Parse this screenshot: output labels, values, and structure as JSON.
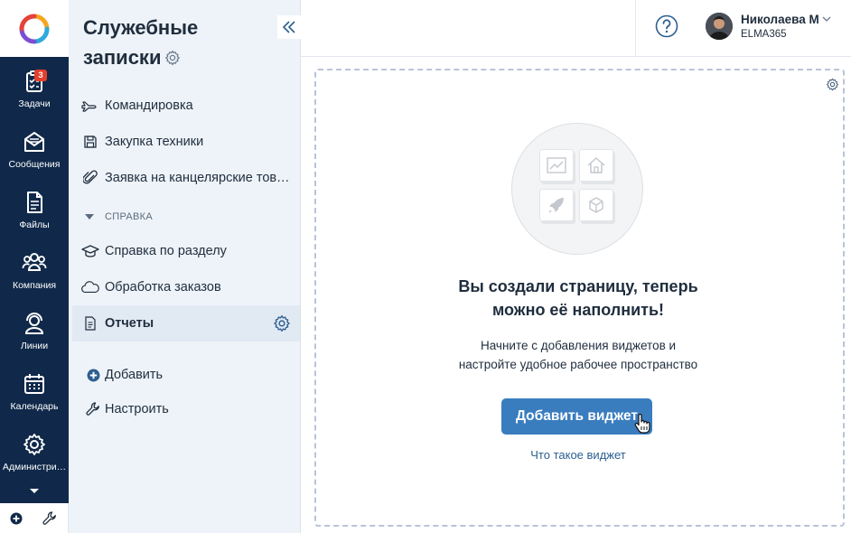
{
  "rail": {
    "items": [
      {
        "label": "Задачи",
        "icon": "clipboard-check-icon",
        "badge": "3"
      },
      {
        "label": "Сообщения",
        "icon": "envelope-icon"
      },
      {
        "label": "Файлы",
        "icon": "file-icon"
      },
      {
        "label": "Компания",
        "icon": "people-icon"
      },
      {
        "label": "Линии",
        "icon": "headset-icon"
      },
      {
        "label": "Календарь",
        "icon": "calendar-icon"
      },
      {
        "label": "Администри…",
        "icon": "gear-icon"
      }
    ]
  },
  "sidebar": {
    "title": "Служебные записки",
    "items": [
      {
        "label": "Командировка",
        "icon": "airplane-icon"
      },
      {
        "label": "Закупка техники",
        "icon": "floppy-icon"
      },
      {
        "label": "Заявка на канцелярские това…",
        "icon": "paperclip-icon"
      }
    ],
    "section": {
      "label": "СПРАВКА",
      "items": [
        {
          "label": "Справка по разделу",
          "icon": "graduation-cap-icon"
        },
        {
          "label": "Обработка заказов",
          "icon": "cloud-icon"
        },
        {
          "label": "Отчеты",
          "icon": "document-icon",
          "active": true
        }
      ]
    },
    "add_label": "Добавить",
    "configure_label": "Настроить"
  },
  "header": {
    "user_name": "Николаева М",
    "user_org": "ELMA365"
  },
  "main": {
    "empty_title_line1": "Вы создали страницу, теперь",
    "empty_title_line2": "можно её наполнить!",
    "empty_desc_line1": "Начните с добавления виджетов и",
    "empty_desc_line2": "настройте удобное рабочее пространство",
    "add_widget_label": "Добавить виджет",
    "what_is_widget_label": "Что такое виджет"
  },
  "colors": {
    "rail_bg": "#10294a",
    "sidebar_bg": "#eef3f9",
    "primary_button": "#3a7dbf",
    "badge": "#e53e2b"
  }
}
